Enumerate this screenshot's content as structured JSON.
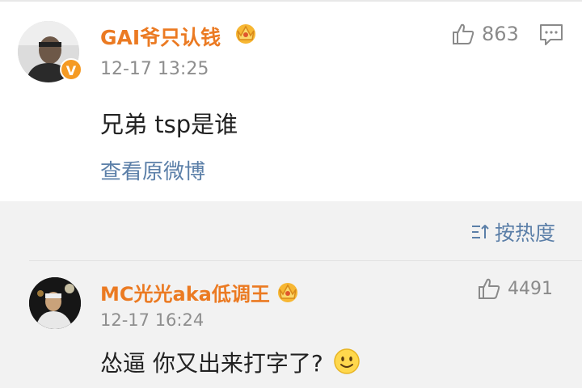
{
  "post": {
    "username": "GAI爷只认钱",
    "timestamp": "12-17 13:25",
    "text": "兄弟 tsp是谁",
    "likes": "863",
    "view_original": "查看原微博",
    "verified_badge": "V"
  },
  "sort": {
    "label": "按热度"
  },
  "reply": {
    "username": "MC光光aka低调王",
    "timestamp": "12-17 16:24",
    "text": "怂逼 你又出来打字了?",
    "likes": "4491"
  },
  "icons": {
    "like": "thumbs-up-icon",
    "reply": "comment-icon",
    "sort": "sort-icon",
    "crown": "crown-badge-icon",
    "smiley": "smiley-emoji-icon"
  },
  "colors": {
    "username": "#eb7a22",
    "link": "#5b7fa8",
    "meta": "#8e8e8e",
    "text": "#222222",
    "background": "#f2f2f2",
    "card": "#ffffff"
  }
}
